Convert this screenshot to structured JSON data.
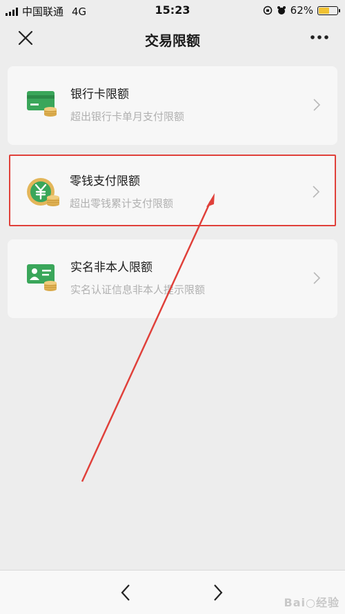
{
  "status_bar": {
    "carrier": "中国联通",
    "network": "4G",
    "time": "15:23",
    "battery": "62%",
    "battery_level": 0.62
  },
  "nav": {
    "title": "交易限额"
  },
  "items": [
    {
      "title": "银行卡限额",
      "desc": "超出银行卡单月支付限额",
      "icon": "bank-card-icon"
    },
    {
      "title": "零钱支付限额",
      "desc": "超出零钱累计支付限额",
      "icon": "yuan-coin-icon",
      "highlighted": true
    },
    {
      "title": "实名非本人限额",
      "desc": "实名认证信息非本人提示限额",
      "icon": "id-card-icon"
    }
  ],
  "watermark": "Bai○经验",
  "colors": {
    "accent_green": "#3aa65a",
    "coin_gold": "#e3b65a",
    "highlight_red": "#e0403a"
  }
}
